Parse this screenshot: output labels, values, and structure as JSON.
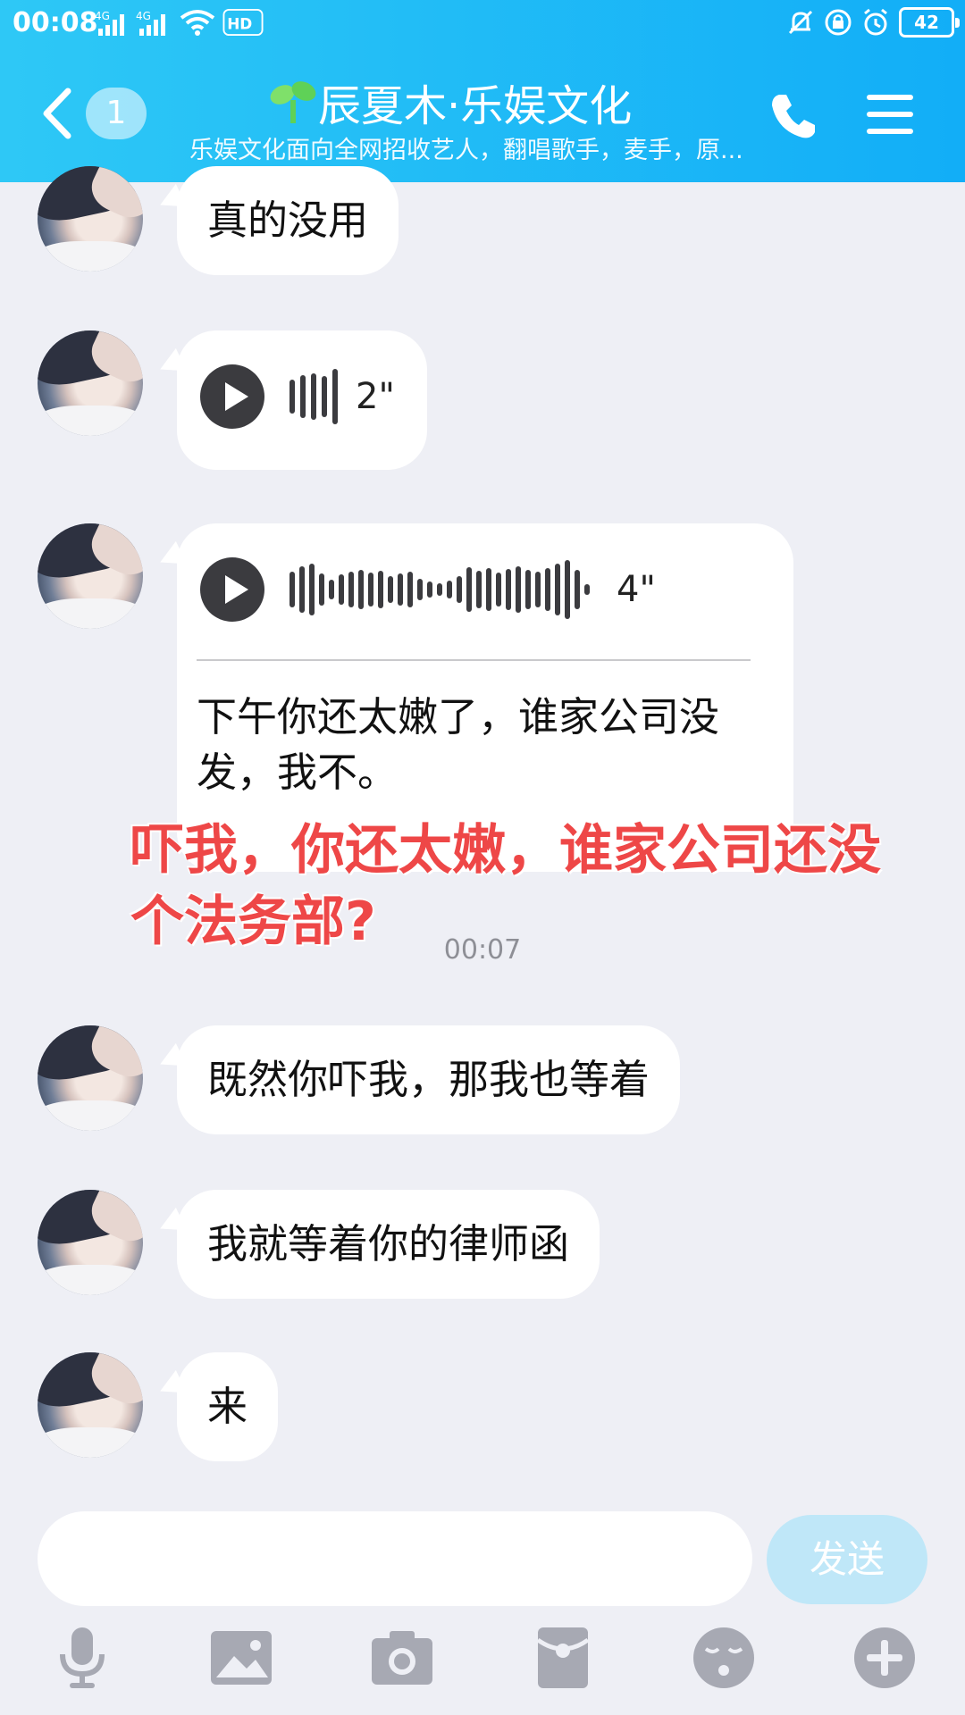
{
  "status_bar": {
    "time": "00:08",
    "signal1": "4G",
    "signal2": "4G",
    "hd": "HD",
    "battery": "42"
  },
  "header": {
    "unread_count": "1",
    "title": "辰夏木·乐娱文化",
    "subtitle": "乐娱文化面向全网招收艺人，翻唱歌手，麦手，原..."
  },
  "messages": [
    {
      "type": "text",
      "text": "真的没用"
    },
    {
      "type": "voice",
      "duration": "2\""
    },
    {
      "type": "voice",
      "duration": "4\"",
      "transcript": "下午你还太嫩了，谁家公司没发，我不。"
    },
    {
      "type": "text",
      "text": "既然你吓我，那我也等着"
    },
    {
      "type": "text",
      "text": "我就等着你的律师函"
    },
    {
      "type": "text",
      "text": "来"
    }
  ],
  "overlay_annotation": "吓我，你还太嫩，谁家公司还没个法务部?",
  "timestamp": "00:07",
  "input": {
    "placeholder": "",
    "value": "",
    "send_label": "发送"
  },
  "toolbar": [
    "mic-icon",
    "image-icon",
    "camera-icon",
    "red-packet-icon",
    "emoji-icon",
    "plus-icon"
  ],
  "colors": {
    "header": "#12aef7",
    "send_disabled": "#bfe7f8",
    "annotation": "#ee4747"
  }
}
